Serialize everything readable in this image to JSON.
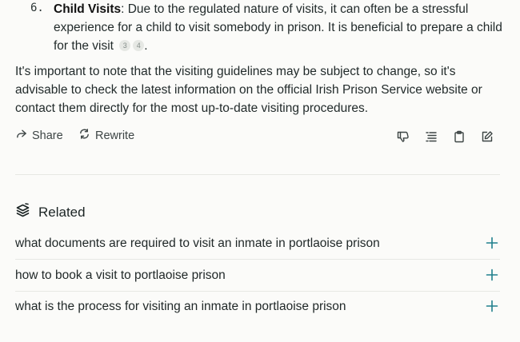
{
  "answer": {
    "list_item": {
      "number": "6.",
      "title": "Child Visits",
      "text": ": Due to the regulated nature of visits, it can often be a stressful experience for a child to visit somebody in prison. It is beneficial to prepare a child for the visit",
      "citations": [
        "3",
        "4"
      ],
      "end": "."
    },
    "paragraph": "It's important to note that the visiting guidelines may be subject to change, so it's advisable to check the latest information on the official Irish Prison Service website or contact them directly for the most up-to-date visiting procedures."
  },
  "actions": {
    "share_label": "Share",
    "rewrite_label": "Rewrite",
    "icons": [
      "thumbs-down-icon",
      "list-view-icon",
      "clipboard-icon",
      "edit-icon"
    ]
  },
  "related": {
    "title": "Related",
    "items": [
      "what documents are required to visit an inmate in portlaoise prison",
      "how to book a visit to portlaoise prison",
      "what is the process for visiting an inmate in portlaoise prison"
    ]
  },
  "colors": {
    "accent": "#20808d",
    "background": "#fbfbf9",
    "text": "#1f2a2a",
    "divider": "#e7e8e4"
  }
}
